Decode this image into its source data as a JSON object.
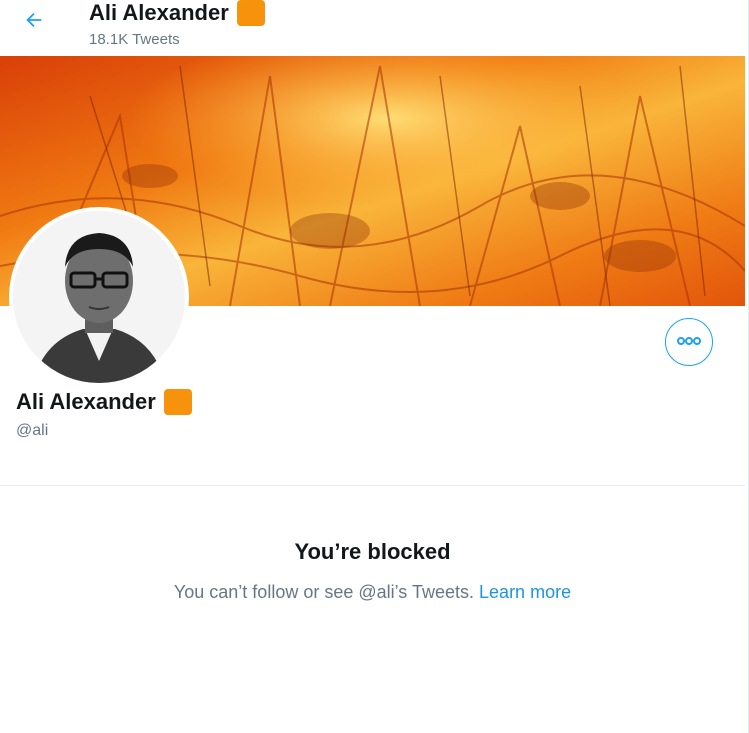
{
  "header": {
    "back_icon": "arrow-left-icon",
    "name": "Ali Alexander",
    "tweet_count": "18.1K Tweets"
  },
  "banner": {
    "description": "orange engraving artwork banner"
  },
  "profile": {
    "name": "Ali Alexander",
    "handle": "@ali",
    "badge_color": "#f7920c",
    "more_icon": "more-horizontal-icon"
  },
  "blocked": {
    "title": "You’re blocked",
    "message": "You can’t follow or see @ali’s Tweets.",
    "learn_more": "Learn more"
  },
  "colors": {
    "accent": "#1da1f2",
    "link": "#1b95e0",
    "secondary_text": "#657786"
  }
}
